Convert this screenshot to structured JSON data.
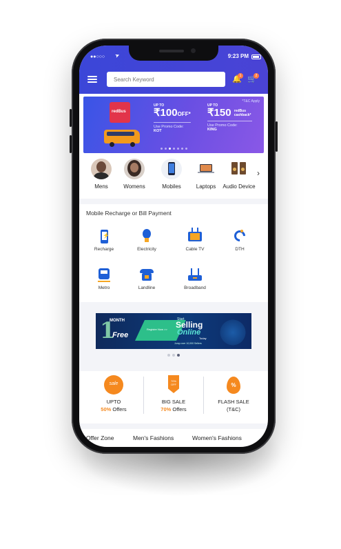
{
  "status": {
    "time": "9:23 PM",
    "signal": "●●○○○"
  },
  "header": {
    "search_placeholder": "Search Keyword",
    "notif_count": "1",
    "cart_count": "2"
  },
  "banner": {
    "tc": "*T&C Apply",
    "offer1": {
      "upto": "UP TO",
      "amount": "₹100",
      "suffix": "OFF*",
      "code_label": "Use Promo Code:",
      "code": "KOT"
    },
    "offer2": {
      "upto": "UP TO",
      "amount": "₹150",
      "suffix": "redBus cashback*",
      "code_label": "Use Promo Code:",
      "code": "KING"
    }
  },
  "categories": [
    {
      "label": "Mens",
      "icon": "man-avatar-icon"
    },
    {
      "label": "Womens",
      "icon": "woman-avatar-icon"
    },
    {
      "label": "Mobiles",
      "icon": "mobile-phone-icon"
    },
    {
      "label": "Laptops",
      "icon": "laptop-icon"
    },
    {
      "label": "Audio Device",
      "icon": "speaker-icon"
    }
  ],
  "recharge": {
    "title": "Mobile Recharge or Bill Payment",
    "items": [
      {
        "label": "Recharge",
        "icon": "phone-recharge-icon"
      },
      {
        "label": "Electricity",
        "icon": "bulb-icon"
      },
      {
        "label": "Cable TV",
        "icon": "tv-icon"
      },
      {
        "label": "DTH",
        "icon": "satellite-dish-icon"
      },
      {
        "label": "Metro",
        "icon": "train-icon"
      },
      {
        "label": "Landline",
        "icon": "telephone-icon"
      },
      {
        "label": "Broadband",
        "icon": "router-icon"
      }
    ]
  },
  "promo": {
    "num": "1",
    "month": "MONTH",
    "free": "Free",
    "register": "Register Now >>",
    "start": "Start",
    "selling": "Selling",
    "online": "Online",
    "today": "Today",
    "join": "Jump over 10,000 Sellers"
  },
  "deals": [
    {
      "icon_text": "sale",
      "line1": "UPTO",
      "hl": "50%",
      "line2": " Offers"
    },
    {
      "icon_text": "70% OFF",
      "line1": "BIG SALE",
      "hl": "70%",
      "line2": " Offers"
    },
    {
      "icon_text": "%",
      "line1": "FLASH SALE",
      "hl": "",
      "line2": "(T&C)"
    }
  ],
  "tabs": [
    "Offer Zone",
    "Men's Fashions",
    "Women's Fashions"
  ]
}
